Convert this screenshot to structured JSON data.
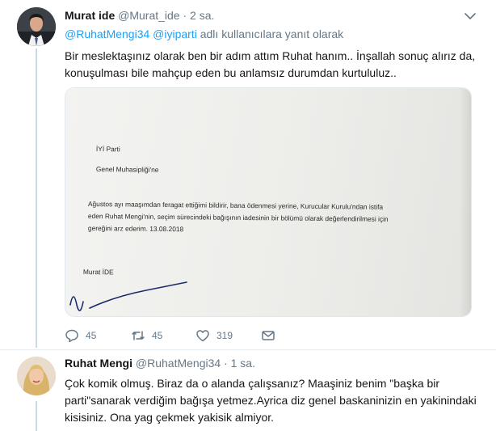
{
  "tweet1": {
    "name": "Murat ide",
    "handle": "@Murat_ide",
    "separator": "·",
    "time": "2 sa.",
    "reply_mentions": "@RuhatMengi34 @iyiparti",
    "reply_suffix": " adlı kullanıcılara yanıt olarak",
    "text": "Bir meslektaşınız olarak ben bir adım attım Ruhat hanım.. İnşallah sonuç alırız da, konuşulması bile mahçup eden bu anlamsız durumdan kurtululuz..",
    "image_doc": {
      "line1": "İYİ Parti",
      "line2": "Genel Muhasipliği'ne",
      "line3": "Ağustos ayı maaşımdan feragat ettiğimi bildirir, bana ödenmesi yerine, Kurucular Kurulu'ndan istifa",
      "line4": "eden Ruhat Mengi'nin, seçim sürecindeki bağışının iadesinin bir bölümü olarak değerlendirilmesi için",
      "line5": "gereğini arz ederim. 13.08.2018",
      "signer": "Murat İDE"
    },
    "actions": {
      "reply_count": "45",
      "retweet_count": "45",
      "like_count": "319"
    },
    "icons": [
      "caret-down-icon",
      "reply-icon",
      "retweet-icon",
      "like-icon",
      "message-icon"
    ]
  },
  "tweet2": {
    "name": "Ruhat Mengi",
    "handle": "@RuhatMengi34",
    "separator": "·",
    "time": "1 sa.",
    "text": "Çok komik olmuş. Biraz da o alanda çalışsanız? Maaşiniz benim \"başka bir parti\"sanarak verdiğim bağışa yetmez.Ayrica diz genel baskaninizin en yakinindaki kisisiniz. Ona yag çekmek yakisik almiyor."
  },
  "colors": {
    "accent": "#1da1f2",
    "muted": "#657786",
    "thread_line": "#c4dbe9",
    "text": "#14171a"
  }
}
